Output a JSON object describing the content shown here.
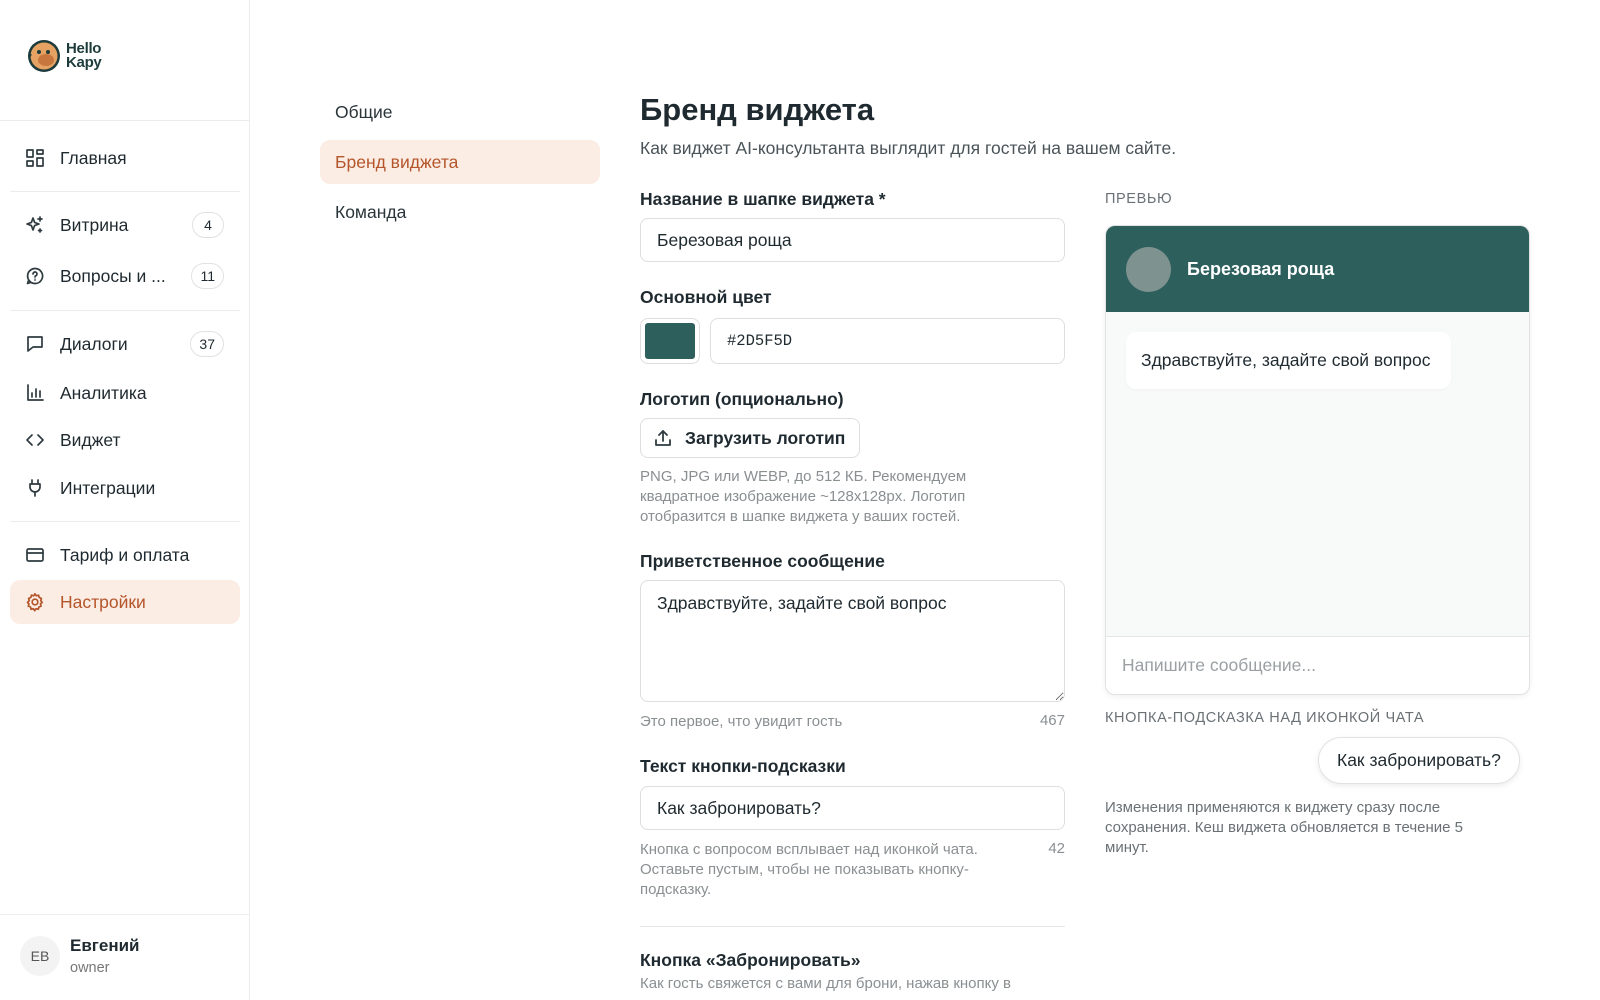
{
  "brand": {
    "name_line1": "Hello",
    "name_line2": "Kapy"
  },
  "sidebar": {
    "items": [
      {
        "label": "Главная",
        "icon": "dashboard-icon",
        "badge": ""
      },
      {
        "label": "Витрина",
        "icon": "sparkles-icon",
        "badge": "4"
      },
      {
        "label": "Вопросы и ...",
        "icon": "question-chat-icon",
        "badge": "11"
      },
      {
        "label": "Диалоги",
        "icon": "chat-icon",
        "badge": "37"
      },
      {
        "label": "Аналитика",
        "icon": "bar-chart-icon",
        "badge": ""
      },
      {
        "label": "Виджет",
        "icon": "code-icon",
        "badge": ""
      },
      {
        "label": "Интеграции",
        "icon": "plug-icon",
        "badge": ""
      },
      {
        "label": "Тариф и оплата",
        "icon": "credit-card-icon",
        "badge": ""
      },
      {
        "label": "Настройки",
        "icon": "gear-icon",
        "badge": "",
        "active": true
      }
    ],
    "user": {
      "initials": "ЕВ",
      "name": "Евгений",
      "role": "owner"
    }
  },
  "subnav": {
    "items": [
      {
        "label": "Общие"
      },
      {
        "label": "Бренд виджета",
        "active": true
      },
      {
        "label": "Команда"
      }
    ]
  },
  "form": {
    "title": "Бренд виджета",
    "subtitle": "Как виджет AI-консультанта выглядит для гостей на вашем сайте.",
    "header_name": {
      "label": "Название в шапке виджета *",
      "value": "Березовая роща"
    },
    "color": {
      "label": "Основной цвет",
      "value": "#2D5F5D"
    },
    "logo": {
      "label": "Логотип (опционально)",
      "button": "Загрузить логотип",
      "hint": "PNG, JPG или WEBP, до 512 КБ. Рекомендуем квадратное изображение ~128x128px. Логотип отобразится в шапке виджета у ваших гостей."
    },
    "greeting": {
      "label": "Приветственное сообщение",
      "value": "Здравствуйте, задайте свой вопрос",
      "hint": "Это первое, что увидит гость",
      "counter": "467"
    },
    "suggest": {
      "label": "Текст кнопки-подсказки",
      "value": "Как забронировать?",
      "hint": "Кнопка с вопросом всплывает над иконкой чата. Оставьте пустым, чтобы не показывать кнопку-подсказку.",
      "counter": "42"
    },
    "book": {
      "label": "Кнопка «Забронировать»",
      "hint": "Как гость свяжется с вами для брони, нажав кнопку в"
    }
  },
  "preview": {
    "label": "Превью",
    "header_title": "Березовая роща",
    "greeting": "Здравствуйте, задайте свой вопрос",
    "input_placeholder": "Напишите сообщение...",
    "suggest_label": "Кнопка-подсказка над иконкой чата",
    "suggest_button": "Как забронировать?",
    "note": "Изменения применяются к виджету сразу после сохранения. Кеш виджета обновляется в течение 5 минут."
  },
  "colors": {
    "accent": "#B4552A",
    "accent_bg": "#FBECE4",
    "brand": "#2D5F5D"
  }
}
